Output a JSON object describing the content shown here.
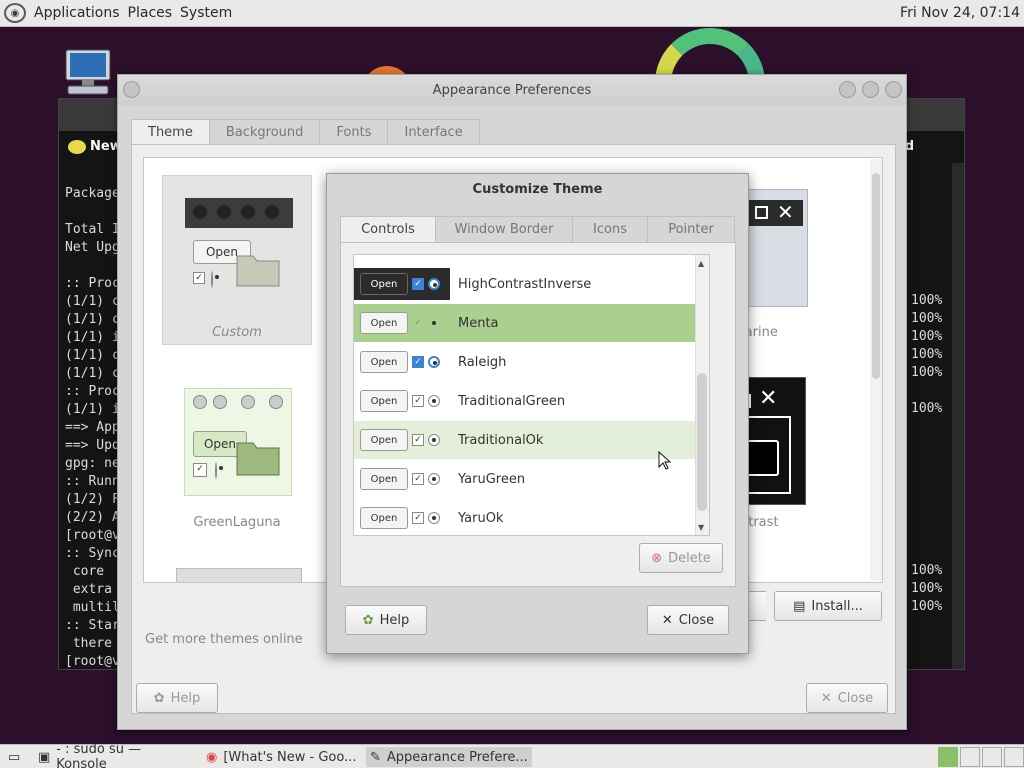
{
  "top_panel": {
    "menus": [
      "Applications",
      "Places",
      "System"
    ],
    "clock": "Fri Nov 24, 07:14"
  },
  "konsole": {
    "tab_label": "New",
    "right_caption": "d",
    "lines": [
      "Package",
      "",
      "Total I",
      "Net Upg",
      "",
      ":: Proc",
      "(1/1) c",
      "(1/1) c",
      "(1/1) i",
      "(1/1) c",
      "(1/1) c",
      ":: Proc",
      "(1/1) i",
      "==> App",
      "==> Upd",
      "gpg: ne",
      ":: Runn",
      "(1/2) F",
      "(2/2) A",
      "[root@v",
      ":: Sync",
      " core",
      " extra",
      " multil",
      ":: Star",
      " there",
      "[root@v"
    ],
    "percents_top": [
      "100%",
      "100%",
      "100%",
      "100%",
      "100%",
      "100%"
    ],
    "percents_bottom": [
      "100%",
      "100%",
      "100%"
    ]
  },
  "appearance": {
    "title": "Appearance Preferences",
    "tabs": [
      "Theme",
      "Background",
      "Fonts",
      "Interface"
    ],
    "themes": {
      "custom": "Custom",
      "green_laguna": "GreenLaguna",
      "partial_right_top": "marine",
      "partial_right_mid": "ntrast"
    },
    "mini_open": "Open",
    "more_themes": "Get more themes online",
    "install_label": "Install...",
    "help_label": "Help",
    "close_label": "Close"
  },
  "customize": {
    "title": "Customize Theme",
    "tabs": [
      "Controls",
      "Window Border",
      "Icons",
      "Pointer"
    ],
    "rows": [
      {
        "name": "HighContrastInverse",
        "style": "dark",
        "selected": false,
        "hover": false
      },
      {
        "name": "Menta",
        "style": "menta",
        "selected": true,
        "hover": false
      },
      {
        "name": "Raleigh",
        "style": "raleigh",
        "selected": false,
        "hover": false
      },
      {
        "name": "TraditionalGreen",
        "style": "plain",
        "selected": false,
        "hover": false
      },
      {
        "name": "TraditionalOk",
        "style": "plain",
        "selected": false,
        "hover": true
      },
      {
        "name": "YaruGreen",
        "style": "yaru",
        "selected": false,
        "hover": false
      },
      {
        "name": "YaruOk",
        "style": "yaru",
        "selected": false,
        "hover": false
      }
    ],
    "mini_open": "Open",
    "delete_label": "Delete",
    "help_label": "Help",
    "close_label": "Close"
  },
  "taskbar": {
    "tasks": [
      {
        "label": "- : sudo su — Konsole",
        "icon": "terminal-icon"
      },
      {
        "label": "[What's New - Goo...",
        "icon": "chrome-icon"
      },
      {
        "label": "Appearance Prefere...",
        "icon": "appearance-icon"
      }
    ]
  },
  "colors": {
    "selected_row": "#a9d08e",
    "hover_row": "#e3efd8",
    "accent_blue": "#3b83d6"
  }
}
